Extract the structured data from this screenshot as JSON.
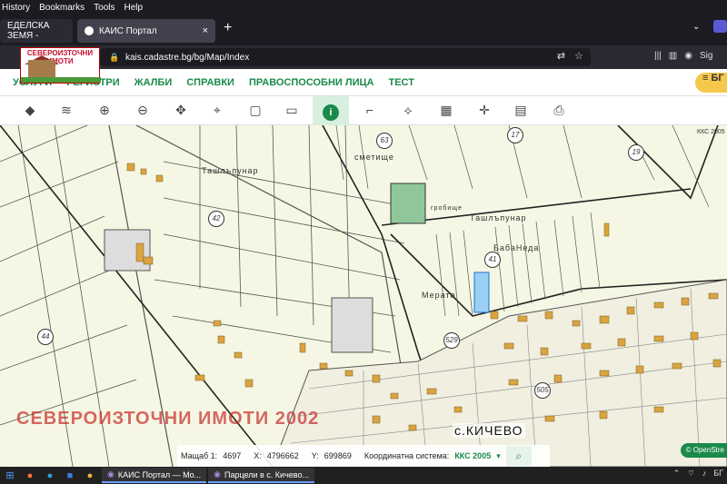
{
  "menu": [
    "History",
    "Bookmarks",
    "Tools",
    "Help"
  ],
  "tabs": [
    {
      "label": "ЕДЕЛСКА ЗЕМЯ - ",
      "close": "×"
    },
    {
      "label": "КАИС Портал",
      "close": "×"
    }
  ],
  "new_tab": "+",
  "url": "kais.cadastre.bg/bg/Map/Index",
  "sign_in": "Sig",
  "logo_text": "СЕВЕРОИЗТОЧНИ ИМОТИ",
  "nav": {
    "items": [
      "УСЛУГИ",
      "РЕГИСТРИ",
      "ЖАЛБИ",
      "СПРАВКИ",
      "ПРАВОСПОСОБНИ ЛИЦА",
      "ТЕСТ"
    ],
    "user_label": "БГ"
  },
  "toolbar_icons": [
    "layers-icon",
    "layers-stack-icon",
    "zoom-in-icon",
    "zoom-out-icon",
    "pan-icon",
    "pin-icon",
    "select-area-icon",
    "deselect-icon",
    "info-icon",
    "measure-icon",
    "polygon-icon",
    "map-icon",
    "coordinates-icon",
    "document-icon",
    "print-icon"
  ],
  "map": {
    "places": [
      "Ташлъпунар",
      "сметище",
      "Ташлъпунар",
      "БабаНеда",
      "Мерата",
      "гробище"
    ],
    "parcel_numbers": [
      "42",
      "44",
      "41",
      "529",
      "63",
      "17",
      "19",
      "505"
    ],
    "village": "с.КИЧЕВО",
    "watermark": "СЕВЕРОИЗТОЧНИ ИМОТИ 2002",
    "coord_label_top": "ККС 2005",
    "osm": "OpenStre"
  },
  "status": {
    "scale_label": "Мащаб 1:",
    "scale_value": "4697",
    "x_label": "X:",
    "x_value": "4796662",
    "y_label": "Y:",
    "y_value": "699869",
    "coord_system_label": "Координатна система:",
    "coord_system_value": "ККС 2005"
  },
  "taskbar": {
    "apps": [
      "КАИС Портал — Mo...",
      "Парцели в с. Кичево..."
    ],
    "tray_lang": "БГ"
  }
}
